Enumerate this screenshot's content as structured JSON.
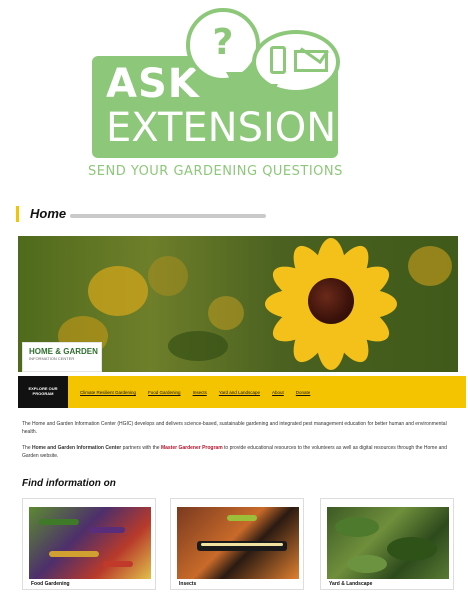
{
  "ask": {
    "line1": "ASK",
    "line2": "EXTENSION",
    "tagline": "SEND YOUR GARDENING QUESTIONS",
    "question_glyph": "?",
    "icons": [
      "question-bubble-icon",
      "phone-icon",
      "envelope-icon"
    ],
    "color": "#8dc87a"
  },
  "hgic": {
    "title": "Home",
    "logo_main": "HOME & GARDEN",
    "logo_sub": "INFORMATION CENTER",
    "accent": "#f5c400"
  },
  "nav": {
    "explore": "EXPLORE OUR PROGRAM",
    "items": [
      "Climate Resilient Gardening",
      "Food Gardening",
      "Insects",
      "Yard and Landscape",
      "About",
      "Donate"
    ]
  },
  "paragraphs": {
    "p1": "The Home and Garden Information Center (HGIC) develops and delivers science-based, sustainable gardening and integrated pest management education for better human and environmental health.",
    "p2_a": "The ",
    "p2_bold": "Home and Garden Information Center",
    "p2_b": " partners with the ",
    "p2_link": "Master Gardener Program",
    "p2_c": " to provide educational resources to the volunteers as well as digital resources through the Home and Garden website."
  },
  "find": {
    "heading": "Find information on",
    "cards": [
      {
        "label": "Food Gardening",
        "image": "vegetables-photo"
      },
      {
        "label": "Insects",
        "image": "caterpillar-photo"
      },
      {
        "label": "Yard & Landscape",
        "image": "leaves-photo"
      }
    ]
  }
}
